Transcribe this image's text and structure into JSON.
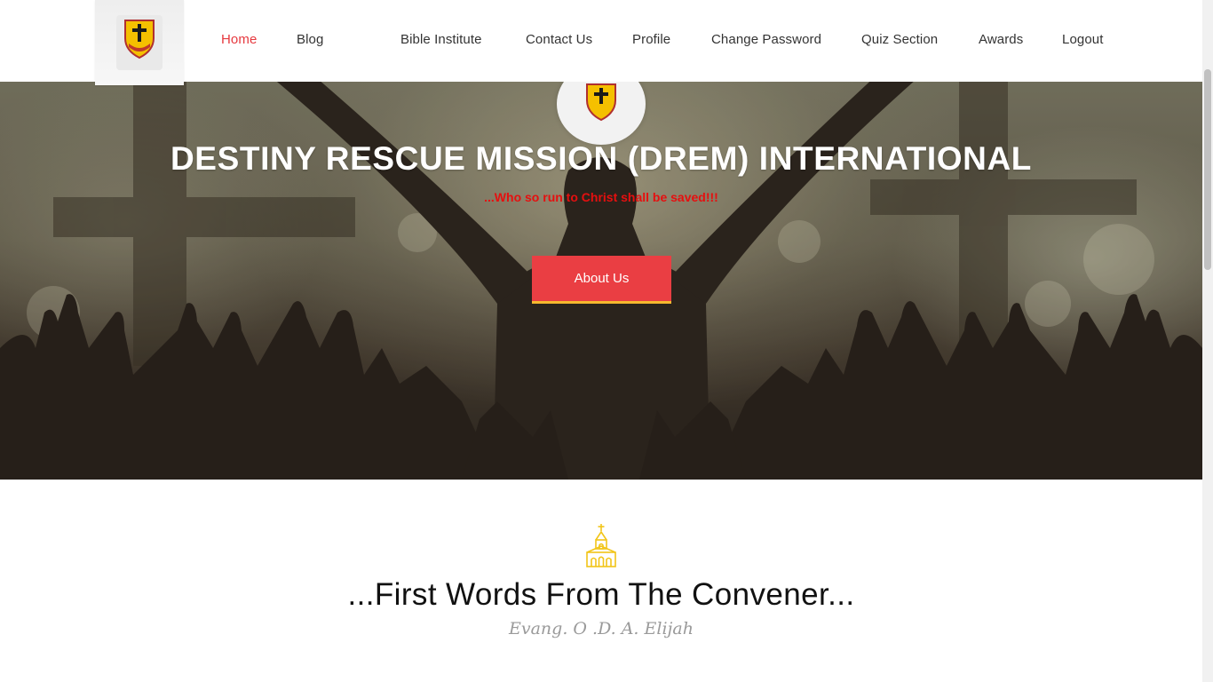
{
  "brand": {
    "logo_text": "DESTINY RESCUE",
    "logo_subtext": "MISSION INTERNATIONAL"
  },
  "nav": {
    "items": [
      {
        "label": "Home",
        "active": true
      },
      {
        "label": "Blog",
        "active": false
      },
      {
        "label": "Bible Institute",
        "active": false
      },
      {
        "label": "Contact Us",
        "active": false
      },
      {
        "label": "Profile",
        "active": false
      },
      {
        "label": "Change Password",
        "active": false
      },
      {
        "label": "Quiz Section",
        "active": false
      },
      {
        "label": "Awards",
        "active": false
      },
      {
        "label": "Logout",
        "active": false
      }
    ]
  },
  "hero": {
    "title": "DESTINY RESCUE MISSION (DREM) INTERNATIONAL",
    "tagline": "...Who so run to Christ shall be saved!!!",
    "button_label": "About Us"
  },
  "section": {
    "icon": "church-icon",
    "title": "...First Words From The Convener...",
    "subtitle": "Evang. O .D. A. Elijah"
  },
  "colors": {
    "accent": "#e6393f",
    "button": "#ea3e43",
    "button_underline": "#f5b82e",
    "tagline": "#e60f0f",
    "icon": "#f2c518"
  }
}
